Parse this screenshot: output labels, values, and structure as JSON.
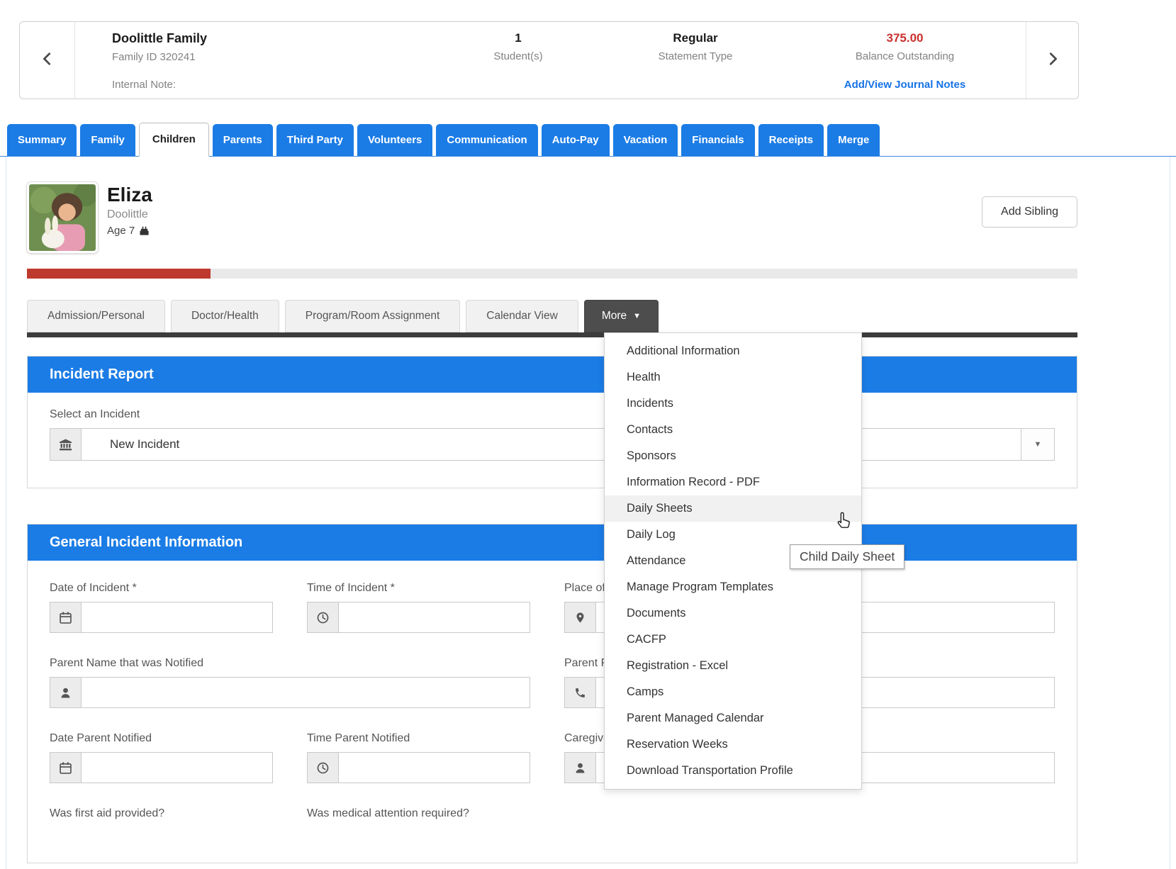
{
  "colors": {
    "accent_blue": "#1b7ce6",
    "balance_red": "#c9302c",
    "progress_red": "#bf3a2e",
    "link_blue": "#1673e6",
    "more_button_dark": "#4d4d4d"
  },
  "family_bar": {
    "name": "Doolittle Family",
    "family_id": "Family ID 320241",
    "internal_note_label": "Internal Note:",
    "students_value": "1",
    "students_label": "Student(s)",
    "statement_value": "Regular",
    "statement_label": "Statement Type",
    "balance_value": "375.00",
    "balance_label": "Balance Outstanding",
    "journal_link": "Add/View Journal Notes"
  },
  "tabs": {
    "items": [
      "Summary",
      "Family",
      "Children",
      "Parents",
      "Third Party",
      "Volunteers",
      "Communication",
      "Auto-Pay",
      "Vacation",
      "Financials",
      "Receipts",
      "Merge"
    ],
    "active": "Children"
  },
  "child": {
    "first_name": "Eliza",
    "last_name": "Doolittle",
    "age": "Age 7",
    "add_sibling": "Add Sibling",
    "profile_progress_percent": 17.5
  },
  "subtabs": {
    "items": [
      "Admission/Personal",
      "Doctor/Health",
      "Program/Room Assignment",
      "Calendar View"
    ],
    "more_label": "More",
    "more_caret": "▼"
  },
  "more_menu": {
    "items": [
      "Additional Information",
      "Health",
      "Incidents",
      "Contacts",
      "Sponsors",
      "Information Record - PDF",
      "Daily Sheets",
      "Daily Log",
      "Attendance",
      "Manage Program Templates",
      "Documents",
      "CACFP",
      "Registration - Excel",
      "Camps",
      "Parent Managed Calendar",
      "Reservation Weeks",
      "Download Transportation Profile"
    ],
    "hovered_item": "Daily Sheets",
    "tooltip": "Child Daily Sheet"
  },
  "incident_report": {
    "title": "Incident Report",
    "select_label": "Select an Incident",
    "selected_value": "New Incident",
    "select_caret": "▼"
  },
  "general_incident": {
    "title": "General Incident Information",
    "labels": {
      "date_of_incident": "Date of Incident *",
      "time_of_incident": "Time of Incident *",
      "place_of_incident": "Place of Incident",
      "parent_name": "Parent Name that was Notified",
      "parent_phone": "Parent Phone that was Notified",
      "date_parent_notified": "Date Parent Notified",
      "time_parent_notified": "Time Parent Notified",
      "caregiver": "Caregiver that was Notified",
      "first_aid": "Was first aid provided?",
      "medical": "Was medical attention required?"
    }
  }
}
